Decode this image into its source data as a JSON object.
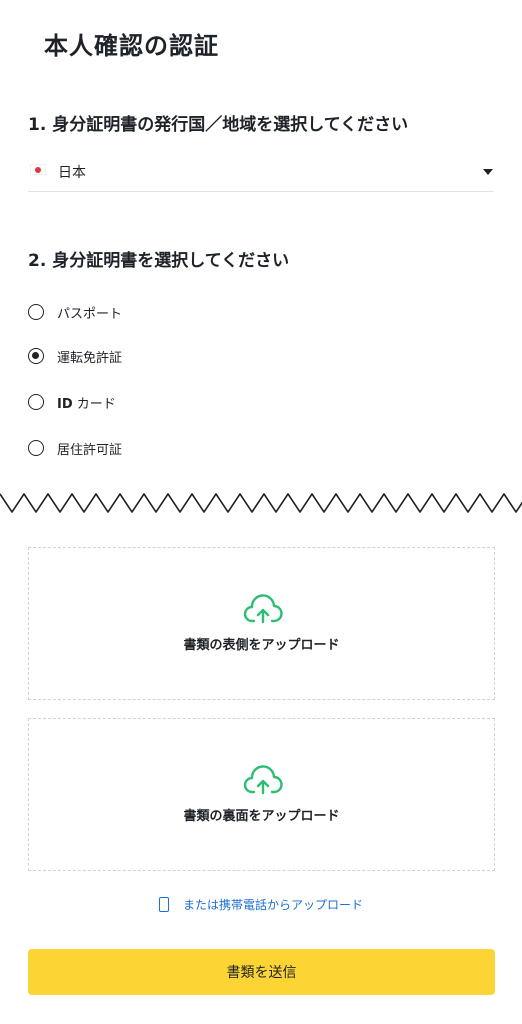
{
  "page_title": "本人確認の認証",
  "section1": {
    "title": "1. 身分証明書の発行国／地域を選択してください",
    "country": "日本"
  },
  "section2": {
    "title": "2. 身分証明書を選択してください",
    "options": [
      {
        "label": "パスポート",
        "selected": false
      },
      {
        "label": "運転免許証",
        "selected": true
      },
      {
        "label_bold": "ID",
        "label": " カード",
        "selected": false
      },
      {
        "label": "居住許可証",
        "selected": false
      }
    ]
  },
  "upload": {
    "front_label": "書類の表側をアップロード",
    "back_label": "書類の裏面をアップロード",
    "mobile_link": "または携帯電話からアップロード"
  },
  "submit_label": "書類を送信",
  "colors": {
    "accent": "#fcd535",
    "link": "#1a6fd6",
    "upload_icon": "#2dbd73",
    "text": "#1e2329"
  },
  "icons": [
    "japan-flag-icon",
    "caret-down-icon",
    "cloud-upload-icon",
    "phone-icon"
  ]
}
